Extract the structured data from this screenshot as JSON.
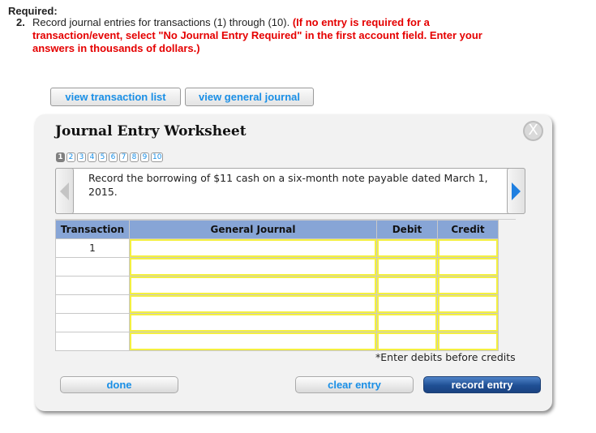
{
  "question": {
    "required_label": "Required:",
    "item_number": "2.",
    "instruction": "Record journal entries for transactions (1) through (10).",
    "note": "(If no entry is required for a transaction/event, select \"No Journal Entry Required\" in the first account field. Enter your answers in thousands of dollars.)"
  },
  "top_buttons": {
    "view_transaction_list": "view transaction list",
    "view_general_journal": "view general journal"
  },
  "worksheet": {
    "title": "Journal Entry Worksheet",
    "close_icon": "close-icon",
    "close_glyph": "X",
    "pages": [
      "1",
      "2",
      "3",
      "4",
      "5",
      "6",
      "7",
      "8",
      "9",
      "10"
    ],
    "active_page": "1",
    "description": "Record the borrowing of $11 cash on a six-month note payable dated March 1, 2015.",
    "table": {
      "headers": [
        "Transaction",
        "General Journal",
        "Debit",
        "Credit"
      ],
      "rows": [
        {
          "transaction": "1",
          "account": "",
          "debit": "",
          "credit": ""
        },
        {
          "transaction": "",
          "account": "",
          "debit": "",
          "credit": ""
        },
        {
          "transaction": "",
          "account": "",
          "debit": "",
          "credit": ""
        },
        {
          "transaction": "",
          "account": "",
          "debit": "",
          "credit": ""
        },
        {
          "transaction": "",
          "account": "",
          "debit": "",
          "credit": ""
        },
        {
          "transaction": "",
          "account": "",
          "debit": "",
          "credit": ""
        }
      ]
    },
    "footnote": "*Enter debits before credits",
    "buttons": {
      "done": "done",
      "clear_entry": "clear entry",
      "record_entry": "record entry"
    }
  },
  "colors": {
    "link_blue": "#1a8fe6",
    "instruction_red": "#e50000",
    "header_blue": "#87a5d6",
    "input_border_yellow": "#f4f040",
    "record_button_blue": "#1f4f94"
  }
}
